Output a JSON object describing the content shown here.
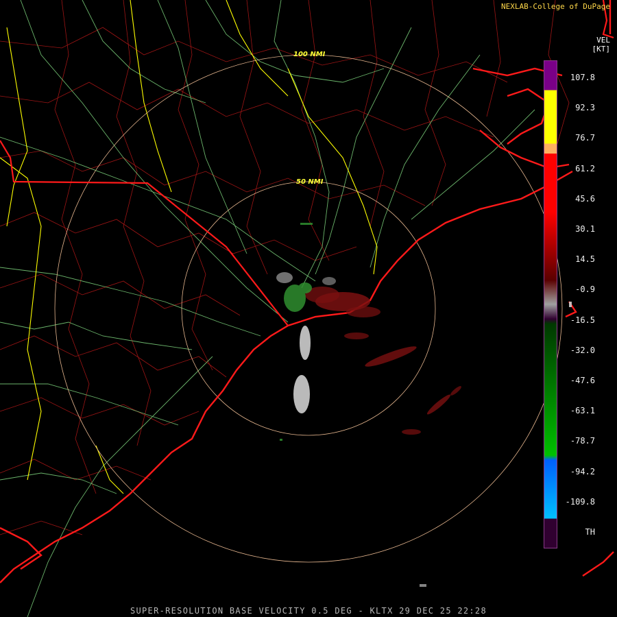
{
  "credit": "NEXLAB-College of DuPage",
  "legend": {
    "product": "VEL",
    "units": "[KT]",
    "ticks": [
      "107.8",
      "92.3",
      "76.7",
      "61.2",
      "45.6",
      "30.1",
      "14.5",
      "-0.9",
      "-16.5",
      "-32.0",
      "-47.6",
      "-63.1",
      "-78.7",
      "-94.2",
      "-109.8",
      "TH"
    ],
    "colors": {
      "purple": "#7a0088",
      "yellow": "#ffff00",
      "orange": "#ffb060",
      "red": "#ff0000",
      "dark_red": "#5a0000",
      "gray": "#a0a0a0",
      "green": "#00c000",
      "blue": "#0060ff",
      "cyan": "#00c0ff",
      "th": "#300030"
    }
  },
  "rings": {
    "inner": "50 NMI",
    "outer": "100 NMI"
  },
  "footer": "SUPER-RESOLUTION BASE VELOCITY 0.5 DEG - KLTX 29 DEC 25 22:28"
}
